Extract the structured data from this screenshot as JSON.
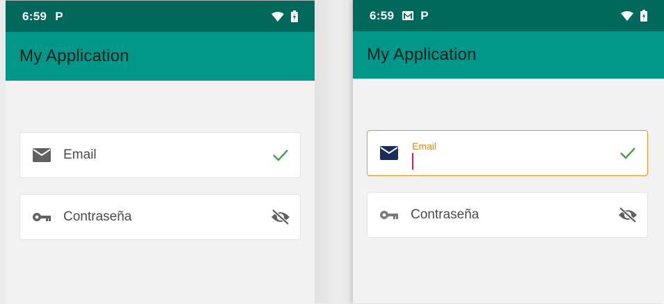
{
  "screens": [
    {
      "id": "unfocused",
      "status": {
        "time": "6:59",
        "notification_icons": [
          "parking-p-icon"
        ],
        "right_icons": [
          "wifi-icon",
          "battery-charging-icon"
        ]
      },
      "app_title": "My Application",
      "email_field": {
        "label": "Email",
        "leading_icon": "mail-icon",
        "trailing_icon": "check-icon",
        "focused": false
      },
      "password_field": {
        "label": "Contraseña",
        "leading_icon": "key-icon",
        "trailing_icon": "visibility-off-icon"
      }
    },
    {
      "id": "focused",
      "status": {
        "time": "6:59",
        "notification_icons": [
          "gmail-icon",
          "parking-p-icon"
        ],
        "right_icons": [
          "wifi-icon",
          "battery-charging-icon"
        ]
      },
      "app_title": "My Application",
      "email_field": {
        "label": "Email",
        "value": "",
        "leading_icon": "mail-icon",
        "trailing_icon": "check-icon",
        "focused": true
      },
      "password_field": {
        "label": "Contraseña",
        "leading_icon": "key-icon",
        "trailing_icon": "visibility-off-icon"
      }
    }
  ],
  "colors": {
    "status_bar": "#00695c",
    "app_bar": "#009688",
    "background": "#f2f2f2",
    "check": "#43a047",
    "focus_border": "#f0911e",
    "floating_label": "#e8860f",
    "cursor": "#d81b60",
    "focused_mail_icon": "#1a2c5b",
    "icon_gray": "#616161"
  },
  "p_glyph": "P"
}
